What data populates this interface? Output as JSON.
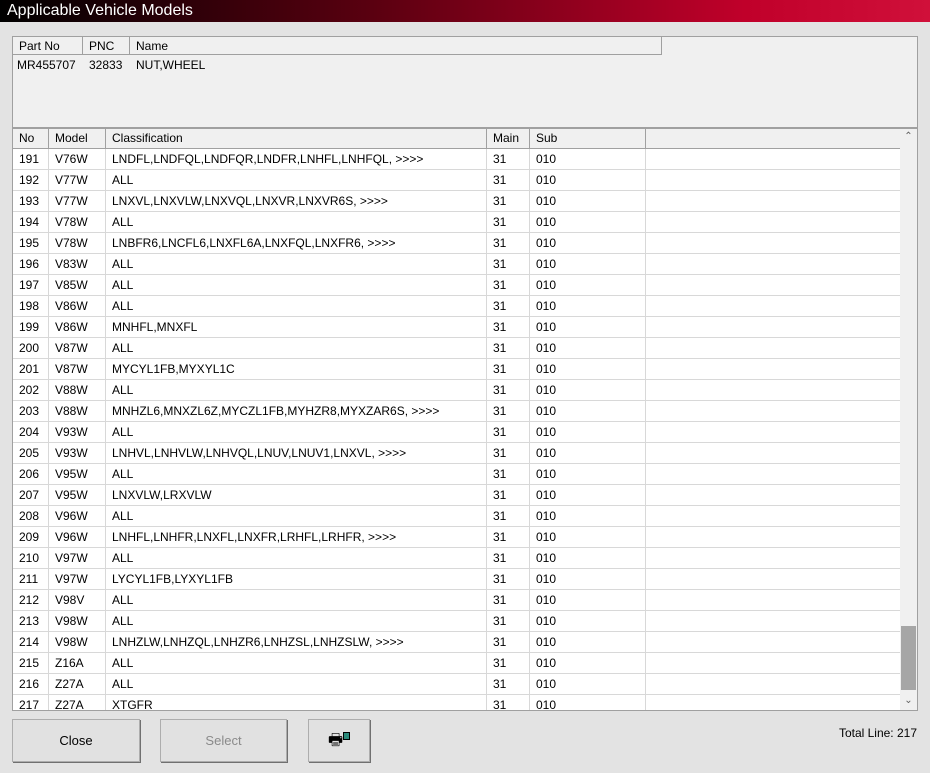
{
  "window": {
    "title": "Applicable Vehicle Models"
  },
  "part_info": {
    "headers": [
      "Part No",
      "PNC",
      "Name"
    ],
    "values": [
      "MR455707",
      "32833",
      "NUT,WHEEL"
    ]
  },
  "grid": {
    "headers": [
      "No",
      "Model",
      "Classification",
      "Main",
      "Sub"
    ],
    "rows": [
      [
        "191",
        "V76W",
        "LNDFL,LNDFQL,LNDFQR,LNDFR,LNHFL,LNHFQL,  >>>>",
        "31",
        "010"
      ],
      [
        "192",
        "V77W",
        "ALL",
        "31",
        "010"
      ],
      [
        "193",
        "V77W",
        "LNXVL,LNXVLW,LNXVQL,LNXVR,LNXVR6S,  >>>>",
        "31",
        "010"
      ],
      [
        "194",
        "V78W",
        "ALL",
        "31",
        "010"
      ],
      [
        "195",
        "V78W",
        "LNBFR6,LNCFL6,LNXFL6A,LNXFQL,LNXFR6,  >>>>",
        "31",
        "010"
      ],
      [
        "196",
        "V83W",
        "ALL",
        "31",
        "010"
      ],
      [
        "197",
        "V85W",
        "ALL",
        "31",
        "010"
      ],
      [
        "198",
        "V86W",
        "ALL",
        "31",
        "010"
      ],
      [
        "199",
        "V86W",
        "MNHFL,MNXFL",
        "31",
        "010"
      ],
      [
        "200",
        "V87W",
        "ALL",
        "31",
        "010"
      ],
      [
        "201",
        "V87W",
        "MYCYL1FB,MYXYL1C",
        "31",
        "010"
      ],
      [
        "202",
        "V88W",
        "ALL",
        "31",
        "010"
      ],
      [
        "203",
        "V88W",
        "MNHZL6,MNXZL6Z,MYCZL1FB,MYHZR8,MYXZAR6S,  >>>>",
        "31",
        "010"
      ],
      [
        "204",
        "V93W",
        "ALL",
        "31",
        "010"
      ],
      [
        "205",
        "V93W",
        "LNHVL,LNHVLW,LNHVQL,LNUV,LNUV1,LNXVL,  >>>>",
        "31",
        "010"
      ],
      [
        "206",
        "V95W",
        "ALL",
        "31",
        "010"
      ],
      [
        "207",
        "V95W",
        "LNXVLW,LRXVLW",
        "31",
        "010"
      ],
      [
        "208",
        "V96W",
        "ALL",
        "31",
        "010"
      ],
      [
        "209",
        "V96W",
        "LNHFL,LNHFR,LNXFL,LNXFR,LRHFL,LRHFR,  >>>>",
        "31",
        "010"
      ],
      [
        "210",
        "V97W",
        "ALL",
        "31",
        "010"
      ],
      [
        "211",
        "V97W",
        "LYCYL1FB,LYXYL1FB",
        "31",
        "010"
      ],
      [
        "212",
        "V98V",
        "ALL",
        "31",
        "010"
      ],
      [
        "213",
        "V98W",
        "ALL",
        "31",
        "010"
      ],
      [
        "214",
        "V98W",
        "LNHZLW,LNHZQL,LNHZR6,LNHZSL,LNHZSLW,  >>>>",
        "31",
        "010"
      ],
      [
        "215",
        "Z16A",
        "ALL",
        "31",
        "010"
      ],
      [
        "216",
        "Z27A",
        "ALL",
        "31",
        "010"
      ],
      [
        "217",
        "Z27A",
        "XTGFR",
        "31",
        "010"
      ]
    ],
    "scroll_position_fraction": 0.95
  },
  "buttons": {
    "close": "Close",
    "select": "Select",
    "print_icon": "printer-icon"
  },
  "status": {
    "total_line": "Total Line: 217"
  }
}
